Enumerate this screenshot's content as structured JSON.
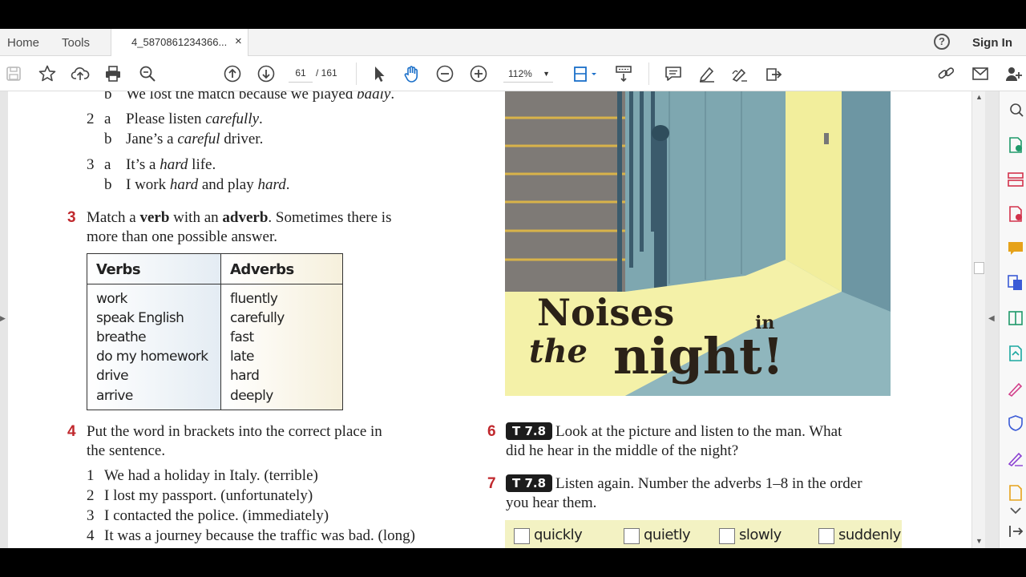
{
  "tabbar": {
    "home": "Home",
    "tools": "Tools",
    "doc_tab": "4_5870861234366...",
    "close": "×",
    "help": "?",
    "sign_in": "Sign In"
  },
  "toolbar": {
    "page_current": "61",
    "page_total": "/ 161",
    "zoom": "112%",
    "icons": [
      "save-icon",
      "bookmark-star-icon",
      "upload-icon",
      "print-icon",
      "zoom-search-icon",
      "page-up-icon",
      "page-down-icon",
      "select-cursor-icon",
      "hand-tool-icon",
      "zoom-out-icon",
      "zoom-in-icon",
      "fit-page-icon",
      "scroll-mode-icon",
      "comment-icon",
      "highlight-pen-icon",
      "sign-icon",
      "share-icon",
      "link-icon",
      "email-icon",
      "add-user-icon"
    ]
  },
  "doc": {
    "ex2": {
      "line1b": {
        "letter": "b",
        "pre": "We lost the match because we played ",
        "it": "badly",
        "post": "."
      },
      "n2": "2",
      "line2a": {
        "letter": "a",
        "pre": "Please listen ",
        "it": "carefully",
        "post": "."
      },
      "line2b": {
        "letter": "b",
        "pre": "Jane’s a ",
        "it": "careful",
        "post": " driver."
      },
      "n3": "3",
      "line3a": {
        "letter": "a",
        "pre": "It’s a ",
        "it": "hard",
        "post": " life."
      },
      "line3b": {
        "letter": "b",
        "pre": "I work ",
        "it": "hard",
        "mid": " and play ",
        "it2": "hard",
        "post": "."
      }
    },
    "ex3": {
      "num": "3",
      "l1_pre": "Match a ",
      "l1_b1": "verb",
      "l1_mid": " with an ",
      "l1_b2": "adverb",
      "l1_post": ". Sometimes there is",
      "l2": "more than one possible answer.",
      "table": {
        "verbs_header": "Verbs",
        "adverbs_header": "Adverbs",
        "verbs": [
          "work",
          "speak English",
          "breathe",
          "do my homework",
          "drive",
          "arrive"
        ],
        "adverbs": [
          "fluently",
          "carefully",
          "fast",
          "late",
          "hard",
          "deeply"
        ]
      }
    },
    "ex4": {
      "num": "4",
      "l1": "Put the word in brackets into the correct place in",
      "l2": "the sentence.",
      "items": [
        {
          "n": "1",
          "text": "We had a holiday in Italy. (terrible)"
        },
        {
          "n": "2",
          "text": "I lost my passport. (unfortunately)"
        },
        {
          "n": "3",
          "text": "I contacted the police. (immediately)"
        },
        {
          "n": "4",
          "text": "It was a journey because the traffic was bad. (long)"
        }
      ]
    },
    "picture": {
      "title_line1": "Noises",
      "title_small": "in",
      "title_line2a": "the",
      "title_line2b": "night!"
    },
    "ex6": {
      "num": "6",
      "badge": "T 7.8",
      "l1": "Look at the picture and listen to the man. What",
      "l2": "did he hear in the middle of the night?"
    },
    "ex7": {
      "num": "7",
      "badge": "T 7.8",
      "l1": "Listen again. Number the adverbs 1–8 in the order",
      "l2": "you hear them.",
      "adverbs": [
        "quickly",
        "quietly",
        "slowly",
        "suddenly"
      ]
    }
  },
  "colors": {
    "accent_red": "#c0282d",
    "adverb_box": "#f3f2c3",
    "badge_bg": "#1c1c1c"
  }
}
